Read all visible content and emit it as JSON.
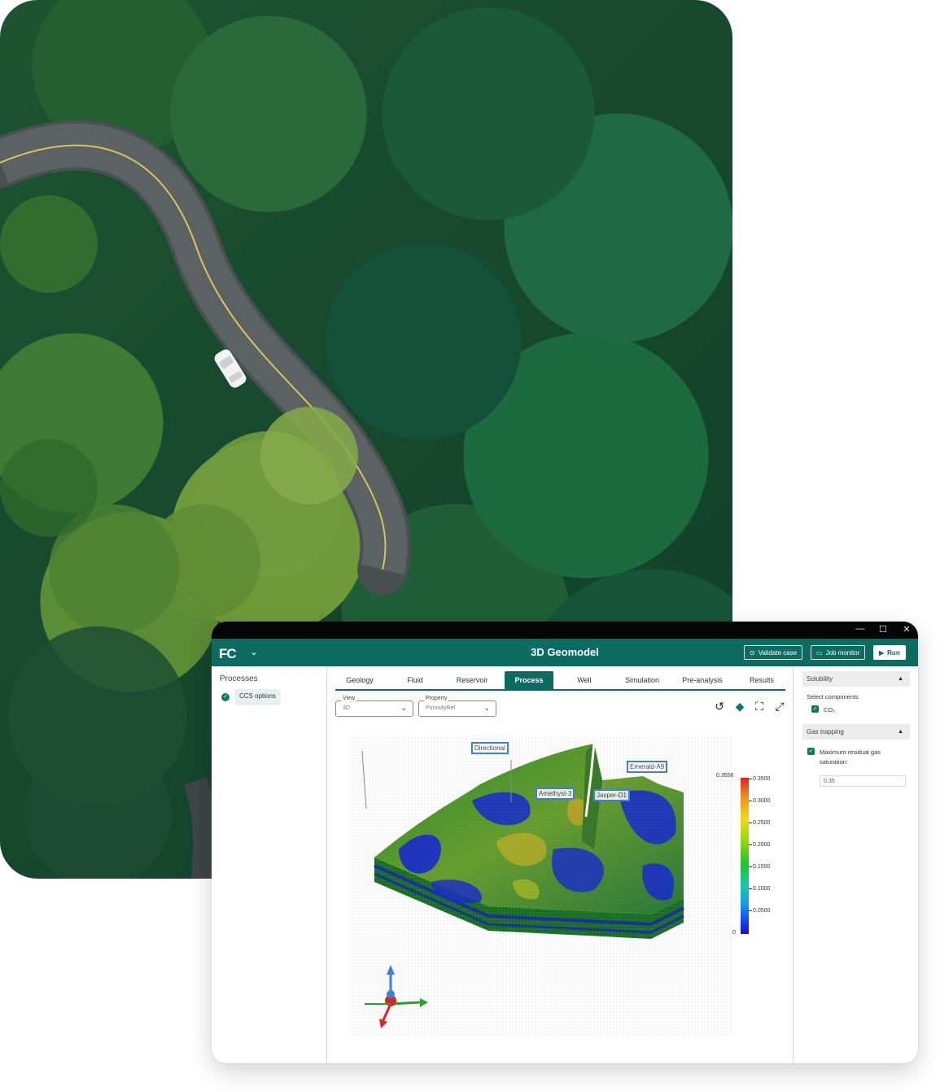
{
  "app": {
    "title": "3D Geomodel",
    "logo": "FC",
    "buttons": {
      "validate": "Validate case",
      "job_monitor": "Job monitor",
      "run": "Run"
    }
  },
  "window_controls": {
    "minimize": "—",
    "maximize": "☐",
    "close": "✕"
  },
  "processes": {
    "title": "Processes",
    "items": [
      {
        "label": "CCS options",
        "status": "done"
      }
    ]
  },
  "tabs": [
    {
      "label": "Geology"
    },
    {
      "label": "Fluid"
    },
    {
      "label": "Reservoir"
    },
    {
      "label": "Process",
      "active": true
    },
    {
      "label": "Well"
    },
    {
      "label": "Simulation"
    },
    {
      "label": "Pre-analysis"
    },
    {
      "label": "Results"
    }
  ],
  "view_controls": {
    "view": {
      "label": "View",
      "value": "3D"
    },
    "property": {
      "label": "Property",
      "value": "PorosityRef"
    }
  },
  "toolbar_icons": [
    "reset-view-icon",
    "region-icon",
    "fullscreen-icon",
    "expand-icon"
  ],
  "wells": [
    {
      "label": "Directional"
    },
    {
      "label": "Emerald-A9"
    },
    {
      "label": "Amethyst-3"
    },
    {
      "label": "Jasper-D1"
    }
  ],
  "colorbar": {
    "max_label": "0.3556",
    "min_label": "0",
    "ticks": [
      "0.3500",
      "0.3000",
      "0.2500",
      "0.2000",
      "0.1500",
      "0.1000",
      "0.0500"
    ],
    "tick_values": [
      0.35,
      0.3,
      0.25,
      0.2,
      0.15,
      0.1,
      0.05
    ],
    "max": 0.3556,
    "min": 0
  },
  "right_panel": {
    "solubility": {
      "title": "Solubility",
      "select_label": "Select components",
      "component": "CO₂",
      "checked": true
    },
    "gas_trapping": {
      "title": "Gas trapping",
      "option_label_1": "Maximum residual gas",
      "option_label_2": "saturation:",
      "checked": true,
      "value": "0.35"
    }
  },
  "colors": {
    "brand": "#0c6c62",
    "titlebar": "#050505",
    "highlight": "#3b82d6"
  }
}
